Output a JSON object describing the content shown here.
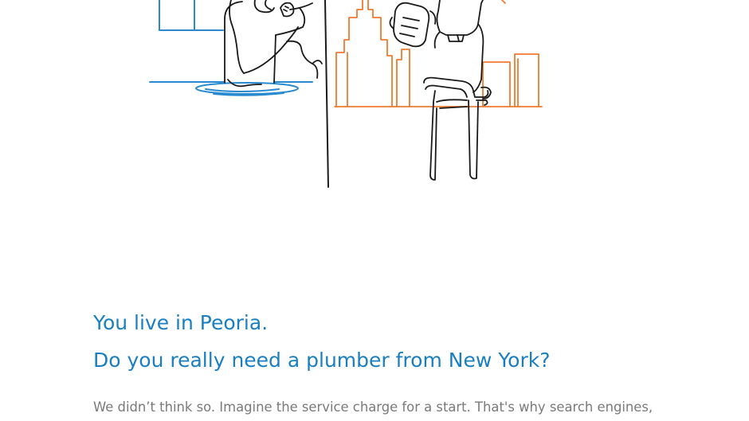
{
  "colors": {
    "headline": "#1a7fc1",
    "body_text": "#7a7a7a",
    "water_city": "#2a8ad0",
    "new_york_city": "#f07a2e",
    "line_art": "#1a1a1a",
    "background": "#ffffff"
  },
  "illustration": {
    "icon": "plumbers-illustration"
  },
  "headline": {
    "line1": "You live in Peoria.",
    "line2": "Do you really need a plumber from New York?"
  },
  "body": {
    "text": "We didn’t think so. Imagine the service charge for a start. That's why search engines,"
  }
}
